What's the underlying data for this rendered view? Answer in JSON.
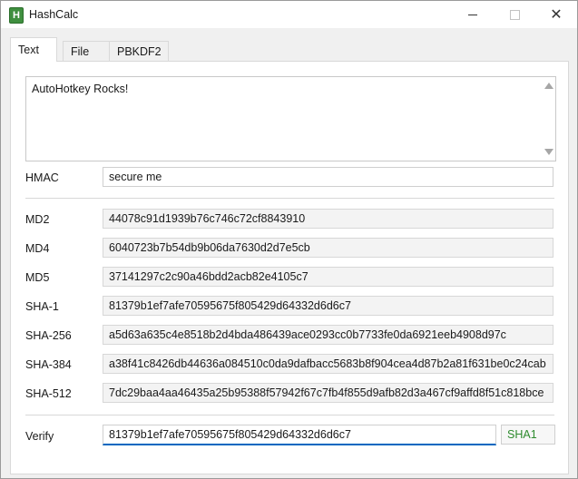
{
  "window": {
    "title": "HashCalc",
    "icon_letter": "H",
    "controls": {
      "close_glyph": "✕"
    }
  },
  "tabs": [
    {
      "label": "Text",
      "selected": true
    },
    {
      "label": "File",
      "selected": false
    },
    {
      "label": "PBKDF2",
      "selected": false
    }
  ],
  "input_text": "AutoHotkey Rocks!",
  "hmac": {
    "label": "HMAC",
    "value": "secure me"
  },
  "hashes": [
    {
      "label": "MD2",
      "value": "44078c91d1939b76c746c72cf8843910"
    },
    {
      "label": "MD4",
      "value": "6040723b7b54db9b06da7630d2d7e5cb"
    },
    {
      "label": "MD5",
      "value": "37141297c2c90a46bdd2acb82e4105c7"
    },
    {
      "label": "SHA-1",
      "value": "81379b1ef7afe70595675f805429d64332d6d6c7"
    },
    {
      "label": "SHA-256",
      "value": "a5d63a635c4e8518b2d4bda486439ace0293cc0b7733fe0da6921eeb4908d97c"
    },
    {
      "label": "SHA-384",
      "value": "a38f41c8426db44636a084510c0da9dafbacc5683b8f904cea4d87b2a81f631be0c24cab"
    },
    {
      "label": "SHA-512",
      "value": "7dc29baa4aa46435a25b95388f57942f67c7fb4f855d9afb82d3a467cf9affd8f51c818bce"
    }
  ],
  "verify": {
    "label": "Verify",
    "value": "81379b1ef7afe70595675f805429d64332d6d6c7",
    "match_algorithm": "SHA1",
    "match_color": "#2e8b2e"
  },
  "colors": {
    "accent": "#0067c0",
    "app_icon": "#3f8f3f"
  }
}
